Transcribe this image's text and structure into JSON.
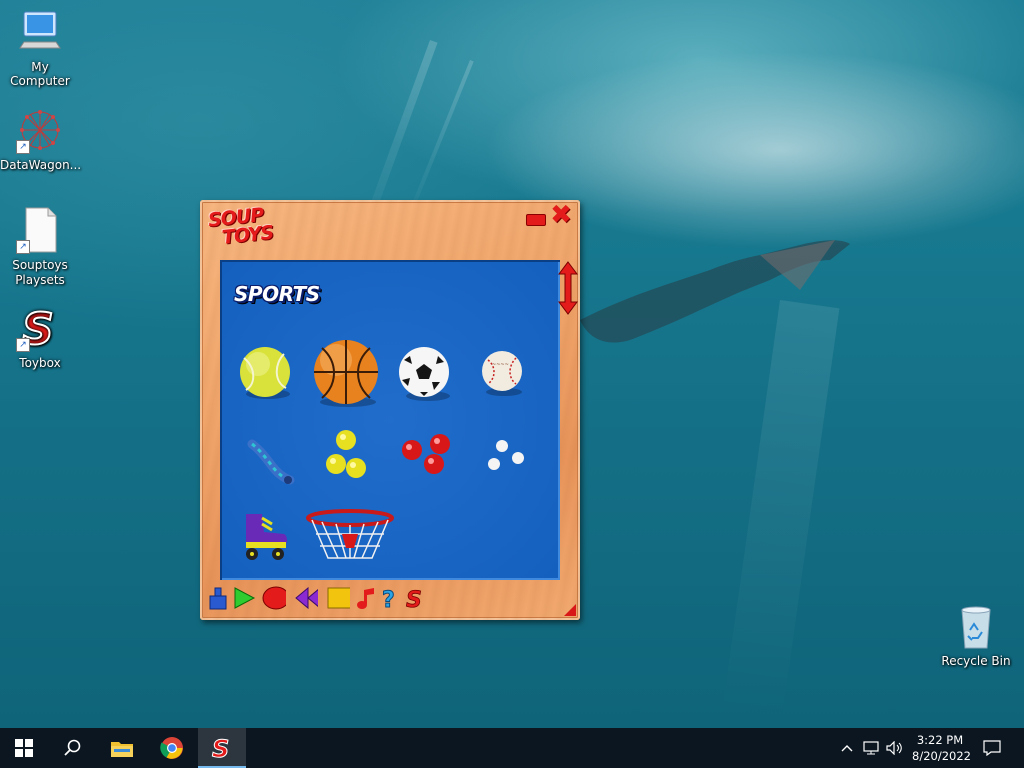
{
  "desktop": {
    "icons": [
      {
        "label": "My Computer",
        "icon": "computer-icon"
      },
      {
        "label": "DataWagon...",
        "icon": "datawagon-molecule-icon"
      },
      {
        "label": "Souptoys\nPlaysets",
        "icon": "document-icon"
      },
      {
        "label": "Toybox",
        "icon": "souptoys-s-logo-icon"
      }
    ],
    "recycle_bin": {
      "label": "Recycle Bin",
      "icon": "recycle-bin-icon"
    }
  },
  "app": {
    "logo_line1": "SOUP",
    "logo_line2": "TOYS",
    "panel_title": "SPORTS",
    "accent_color": "#e31b1b",
    "panel_color": "#1565c8",
    "toys": [
      {
        "name": "tennis ball",
        "icon": "tennis-ball-icon"
      },
      {
        "name": "basketball",
        "icon": "basketball-icon"
      },
      {
        "name": "soccer ball",
        "icon": "soccer-ball-icon"
      },
      {
        "name": "baseball",
        "icon": "baseball-icon"
      },
      {
        "name": "skipping rope",
        "icon": "rope-icon"
      },
      {
        "name": "yellow balls",
        "icon": "yellow-balls-icon"
      },
      {
        "name": "red balls",
        "icon": "red-balls-icon"
      },
      {
        "name": "white balls",
        "icon": "white-balls-icon"
      },
      {
        "name": "roller skate",
        "icon": "roller-skate-icon"
      },
      {
        "name": "basketball hoop",
        "icon": "basketball-hoop-icon"
      }
    ],
    "toolbar": [
      "save-icon",
      "play-icon",
      "record-icon",
      "rewind-icon",
      "stop-icon",
      "music-icon",
      "help-icon",
      "souptoys-s-icon"
    ]
  },
  "taskbar": {
    "items": [
      "windows-start-icon",
      "search-icon",
      "file-explorer-icon",
      "chrome-icon",
      "souptoys-app-icon"
    ],
    "tray": [
      "chevron-up-icon",
      "network-icon",
      "volume-icon"
    ],
    "time": "3:22 PM",
    "date": "8/20/2022",
    "notification_icon": "notification-icon"
  }
}
